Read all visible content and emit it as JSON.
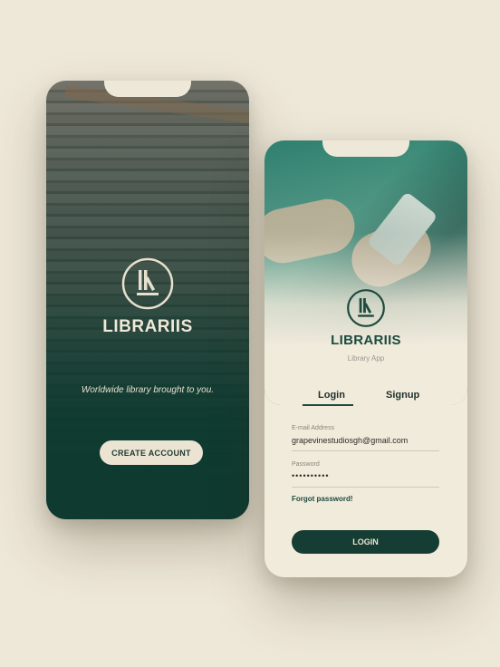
{
  "welcome_screen": {
    "brand": "LIBRARIIS",
    "tagline": "Worldwide library brought to you.",
    "create_account_label": "CREATE ACCOUNT"
  },
  "login_screen": {
    "brand": "LIBRARIIS",
    "subtitle": "Library App",
    "tabs": [
      {
        "label": "Login",
        "active": true
      },
      {
        "label": "Signup",
        "active": false
      }
    ],
    "email": {
      "label": "E-mail Address",
      "value": "grapevinestudiosgh@gmail.com"
    },
    "password": {
      "label": "Password",
      "value": "••••••••••"
    },
    "forgot_label": "Forgot password!",
    "login_label": "LOGIN"
  },
  "colors": {
    "background": "#eee8d9",
    "brand_dark_green": "#153d33",
    "cream": "#ece4d3"
  },
  "icons": [
    "library-logo-icon"
  ]
}
